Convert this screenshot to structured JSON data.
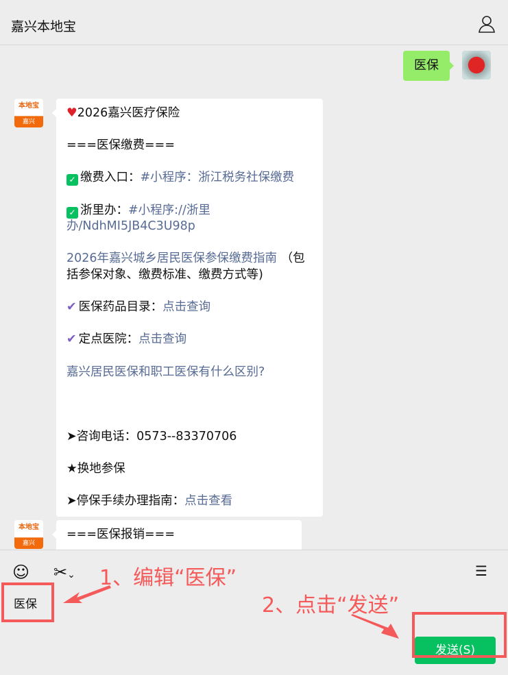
{
  "header": {
    "title": "嘉兴本地宝"
  },
  "logo": {
    "top": "本地宝",
    "bottom": "嘉兴"
  },
  "sent_message": "医保",
  "message1": [
    [
      {
        "t": "2026嘉兴医疗保险",
        "icon": "heart"
      }
    ],
    [
      {
        "t": "===医保缴费==="
      }
    ],
    [
      {
        "t": "缴费入口：",
        "icon": "check"
      },
      {
        "t": "#小程序：浙江税务社保缴费",
        "link": true
      }
    ],
    [
      {
        "t": "浙里办：",
        "icon": "check"
      },
      {
        "t": "#小程序://浙里办/NdhMI5JB4C3U98p",
        "link": true
      }
    ],
    [
      {
        "t": "2026年嘉兴城乡居民医保参保缴费指南",
        "link": true
      },
      {
        "t": " （包括参保对象、缴费标准、缴费方式等)"
      }
    ],
    [
      {
        "t": "医保药品目录：",
        "icon": "tick"
      },
      {
        "t": "点击查询",
        "link": true
      }
    ],
    [
      {
        "t": "定点医院：",
        "icon": "tick"
      },
      {
        "t": "点击查询",
        "link": true
      }
    ],
    [
      {
        "t": "嘉兴居民医保和职工医保有什么区别?",
        "link": true
      }
    ],
    [
      {
        "t": ""
      }
    ],
    [
      {
        "t": "➤咨询电话：0573--83370706"
      }
    ],
    [
      {
        "t": "★换地参保"
      }
    ],
    [
      {
        "t": "➤停保手续办理指南：",
        "link": false
      },
      {
        "t": "点击查看",
        "link": true
      }
    ]
  ],
  "message2": "===医保报销===",
  "input_value": "医保",
  "send_label": "发送(S)",
  "annotations": {
    "step1": "1、编辑“医保”",
    "step2": "2、点击“发送”"
  },
  "colors": {
    "link": "#576b95",
    "send": "#07c160",
    "annotation": "#f45a5a"
  }
}
